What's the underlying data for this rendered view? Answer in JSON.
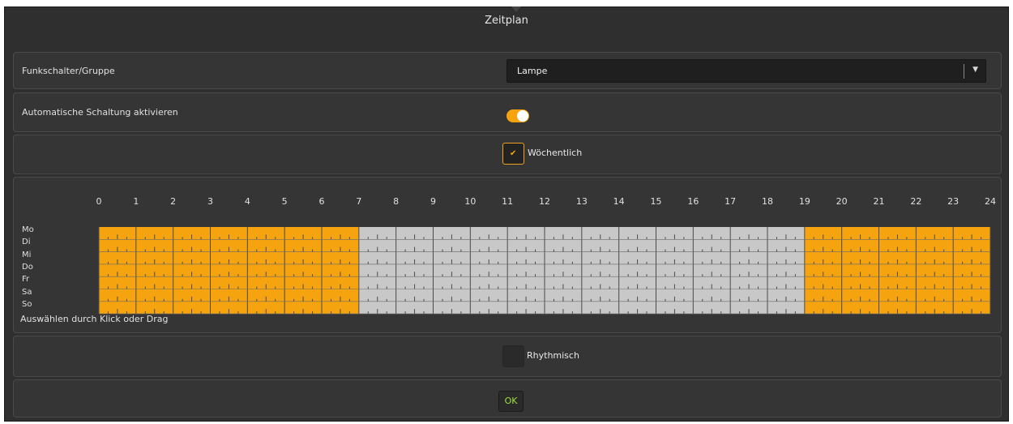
{
  "dialog": {
    "title": "Zeitplan"
  },
  "device_row": {
    "label": "Funkschalter/Gruppe",
    "selected": "Lampe"
  },
  "auto_row": {
    "label": "Automatische Schaltung aktivieren",
    "enabled": true
  },
  "weekly": {
    "label": "Wöchentlich",
    "checked": true
  },
  "schedule": {
    "hours": [
      "0",
      "1",
      "2",
      "3",
      "4",
      "5",
      "6",
      "7",
      "8",
      "9",
      "10",
      "11",
      "12",
      "13",
      "14",
      "15",
      "16",
      "17",
      "18",
      "19",
      "20",
      "21",
      "22",
      "23",
      "24"
    ],
    "days": [
      "Mo",
      "Di",
      "Mi",
      "Do",
      "Fr",
      "Sa",
      "So"
    ],
    "active_ranges": [
      [
        0,
        7
      ],
      [
        19,
        24
      ]
    ],
    "hint": "Auswählen durch Klick oder Drag",
    "colors": {
      "active": "#f5a40f",
      "inactive": "#c8c8c8",
      "divider": "#4a4a4a"
    }
  },
  "rhythmic": {
    "label": "Rhythmisch",
    "checked": false
  },
  "ok": {
    "label": "OK"
  }
}
